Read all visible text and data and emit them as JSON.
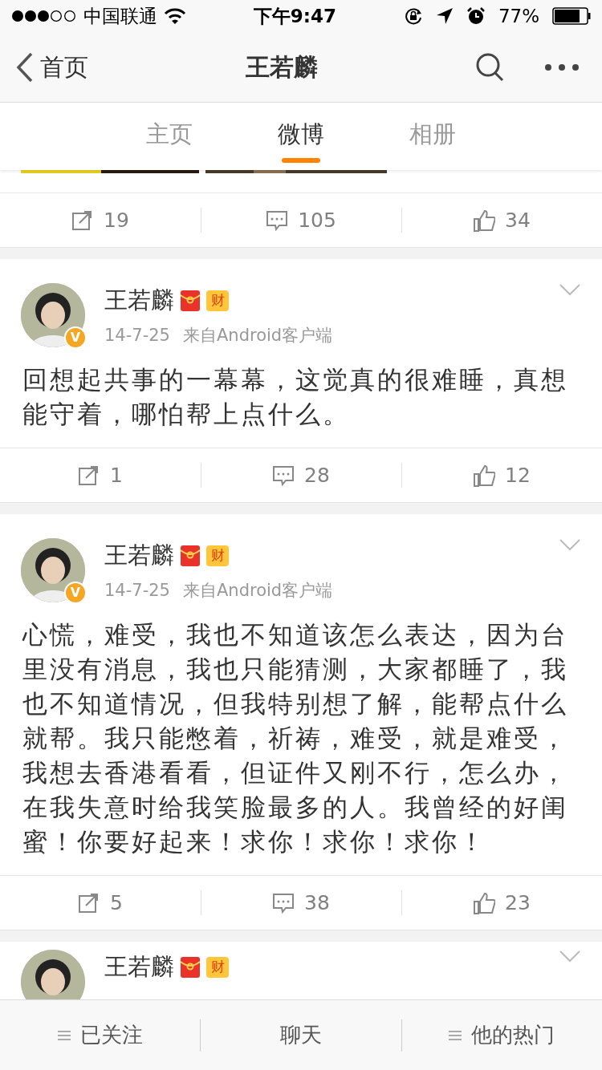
{
  "status_bar": {
    "carrier": "中国联通",
    "time": "下午9:47",
    "battery": "77%"
  },
  "nav": {
    "back": "首页",
    "title": "王若麟"
  },
  "tabs": [
    {
      "label": "主页",
      "selected": false
    },
    {
      "label": "微博",
      "selected": true
    },
    {
      "label": "相册",
      "selected": false
    }
  ],
  "previous_post": {
    "kind": "picture",
    "actions": {
      "repost": "19",
      "comment": "105",
      "like": "34"
    }
  },
  "posts": [
    {
      "author": "王若麟",
      "verified_mark": "V",
      "badges": [
        {
          "kind": "hongbao"
        },
        {
          "kind": "cai",
          "label": "财"
        }
      ],
      "date": "14-7-25",
      "source": "来自Android客户端",
      "text": "回想起共事的一幕幕，这觉真的很难睡，真想能守着，哪怕帮上点什么。",
      "actions": {
        "repost": "1",
        "comment": "28",
        "like": "12"
      }
    },
    {
      "author": "王若麟",
      "verified_mark": "V",
      "badges": [
        {
          "kind": "hongbao"
        },
        {
          "kind": "cai",
          "label": "财"
        }
      ],
      "date": "14-7-25",
      "source": "来自Android客户端",
      "text": "心慌，难受，我也不知道该怎么表达，因为台里没有消息，我也只能猜测，大家都睡了，我也不知道情况，但我特别想了解，能帮点什么就帮。我只能憋着，祈祷，难受，就是难受，我想去香港看看，但证件又刚不行，怎么办，在我失意时给我笑脸最多的人。我曾经的好闺蜜！你要好起来！求你！求你！求你！",
      "actions": {
        "repost": "5",
        "comment": "38",
        "like": "23"
      }
    },
    {
      "author": "王若麟",
      "badges": [
        {
          "kind": "hongbao"
        },
        {
          "kind": "cai",
          "label": "财"
        }
      ]
    }
  ],
  "bottom_bar": [
    {
      "label": "已关注",
      "menu": true
    },
    {
      "label": "聊天",
      "menu": false
    },
    {
      "label": "他的热门",
      "menu": true
    }
  ]
}
